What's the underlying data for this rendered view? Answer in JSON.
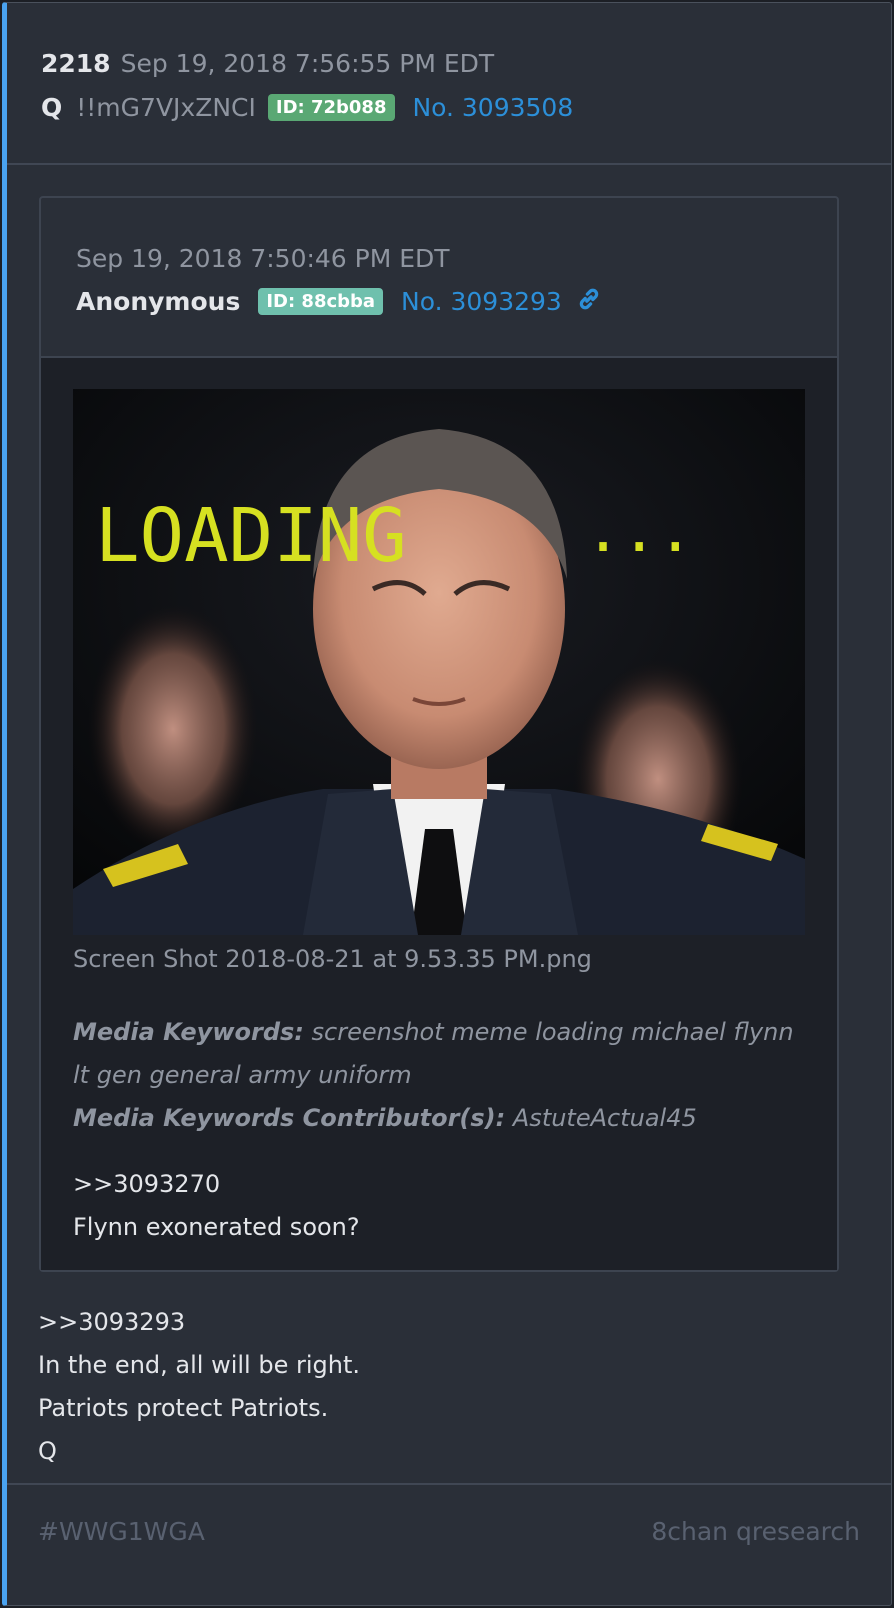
{
  "header": {
    "post_count": "2218",
    "timestamp": "Sep 19, 2018 7:56:55 PM EDT",
    "author": "Q",
    "tripcode": "!!mG7VJxZNCI",
    "id_label": "ID: 72b088",
    "post_number": "No. 3093508",
    "id_color": "#5aa874"
  },
  "quoted_post": {
    "timestamp": "Sep 19, 2018 7:50:46 PM EDT",
    "author": "Anonymous",
    "id_label": "ID: 88cbba",
    "post_number": "No. 3093293",
    "id_color": "#6fc0ad",
    "link_icon": "link-icon",
    "image": {
      "overlay_text": "LOADING",
      "overlay_dots": "...",
      "text_color": "#d6e021"
    },
    "filename": "Screen Shot 2018-08-21 at 9.53.35 PM.png",
    "keywords_label": "Media Keywords:",
    "keywords": "screenshot meme loading michael flynn lt gen general army uniform",
    "contributors_label": "Media Keywords Contributor(s):",
    "contributors": "AstuteActual45",
    "text_lines": [
      ">>3093270",
      "Flynn exonerated soon?"
    ]
  },
  "main_post": {
    "text_lines": [
      ">>3093293",
      "In the end, all will be right.",
      "Patriots protect Patriots.",
      "Q"
    ]
  },
  "footer": {
    "hashtag": "#WWG1WGA",
    "source": "8chan qresearch"
  },
  "colors": {
    "accent": "#4aa3f0",
    "link": "#2c8fd8",
    "background": "#2a2f38"
  }
}
